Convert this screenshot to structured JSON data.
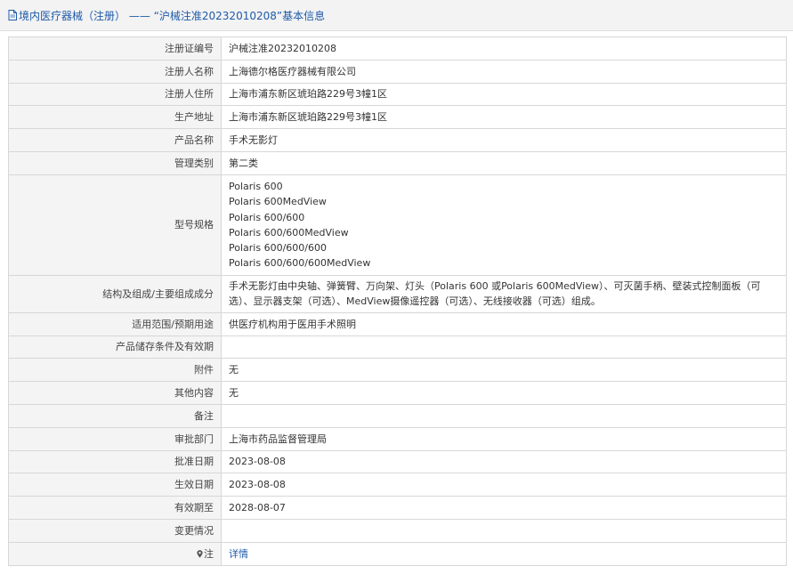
{
  "header": {
    "breadcrumb_link": "境内医疗器械（注册）",
    "separator": "——",
    "record_title": "“沪械注准20232010208”基本信息"
  },
  "fields": [
    {
      "label": "注册证编号",
      "value": "沪械注准20232010208"
    },
    {
      "label": "注册人名称",
      "value": "上海德尔格医疗器械有限公司"
    },
    {
      "label": "注册人住所",
      "value": "上海市浦东新区琥珀路229号3幢1区"
    },
    {
      "label": "生产地址",
      "value": "上海市浦东新区琥珀路229号3幢1区"
    },
    {
      "label": "产品名称",
      "value": "手术无影灯"
    },
    {
      "label": "管理类别",
      "value": "第二类"
    }
  ],
  "models": {
    "label": "型号规格",
    "items": [
      "Polaris 600",
      "Polaris 600MedView",
      "Polaris 600/600",
      "Polaris 600/600MedView",
      "Polaris 600/600/600",
      "Polaris 600/600/600MedView"
    ]
  },
  "composition": {
    "label": "结构及组成/主要组成成分",
    "value": "手术无影灯由中央轴、弹簧臂、万向架、灯头（Polaris 600 或Polaris 600MedView）、可灭菌手柄、壁装式控制面板（可选）、显示器支架（可选）、MedView摄像遥控器（可选）、无线接收器（可选）组成。"
  },
  "fields2": [
    {
      "label": "适用范围/预期用途",
      "value": "供医疗机构用于医用手术照明"
    },
    {
      "label": "产品储存条件及有效期",
      "value": ""
    },
    {
      "label": "附件",
      "value": "无"
    },
    {
      "label": "其他内容",
      "value": "无"
    },
    {
      "label": "备注",
      "value": ""
    },
    {
      "label": "审批部门",
      "value": "上海市药品监督管理局"
    },
    {
      "label": "批准日期",
      "value": "2023-08-08"
    },
    {
      "label": "生效日期",
      "value": "2023-08-08"
    },
    {
      "label": "有效期至",
      "value": "2028-08-07"
    },
    {
      "label": "变更情况",
      "value": ""
    }
  ],
  "notes": {
    "label": "注",
    "link": "详情",
    "icon": "pin-icon"
  },
  "colors": {
    "link": "#1e5aa8",
    "label_bg": "#f4f4f4",
    "border": "#d7d7d7",
    "header_bg": "#f3f3f3"
  }
}
